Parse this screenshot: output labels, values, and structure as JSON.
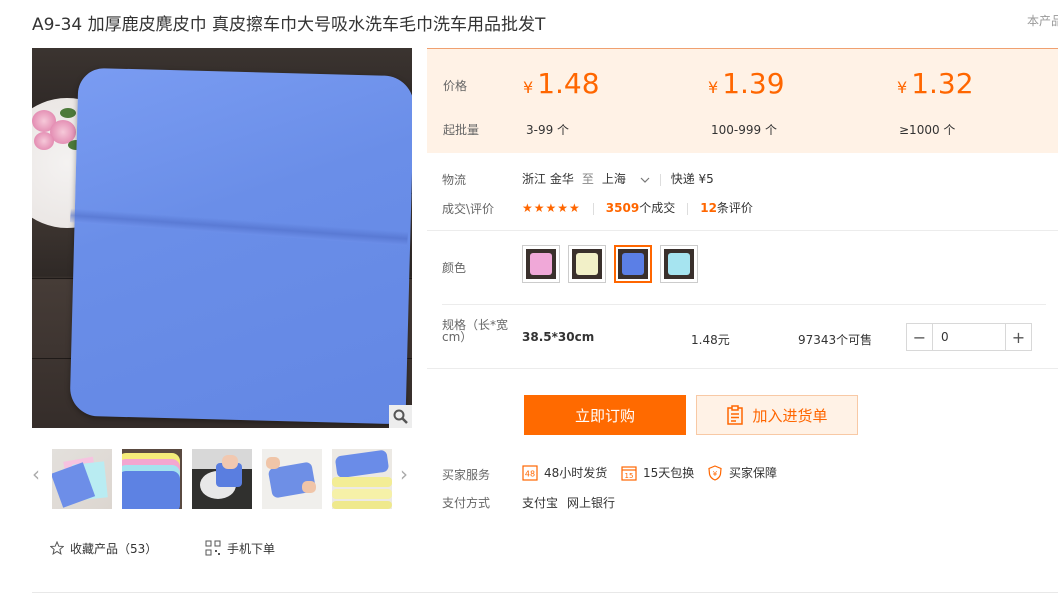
{
  "title": "A9-34 加厚鹿皮麂皮巾 真皮擦车巾大号吸水洗车毛巾洗车用品批发T",
  "title_right": "本产品",
  "price_panel": {
    "price_label": "价格",
    "qty_label": "起批量",
    "currency": "¥",
    "tiers": [
      {
        "price": "1.48",
        "qty": "3-99 个"
      },
      {
        "price": "1.39",
        "qty": "100-999 个"
      },
      {
        "price": "1.32",
        "qty": "≥1000 个"
      }
    ]
  },
  "logistics": {
    "label": "物流",
    "from": "浙江 金华",
    "to_word": "至",
    "to": "上海",
    "express": "快递 ¥5"
  },
  "deals": {
    "label": "成交\\评价",
    "stars": "★★★★★",
    "deal_count": "3509",
    "deal_suffix": "个成交",
    "review_count": "12",
    "review_suffix": "条评价"
  },
  "color": {
    "label": "颜色",
    "swatches": [
      {
        "name": "pink",
        "color": "#f0a8d8"
      },
      {
        "name": "cream",
        "color": "#f2f0c8"
      },
      {
        "name": "blue",
        "color": "#5b7fe6"
      },
      {
        "name": "light-blue",
        "color": "#a6e4f0"
      }
    ],
    "selected_index": 2
  },
  "spec": {
    "label": "规格（长*宽cm）",
    "size": "38.5*30cm",
    "price": "1.48元",
    "stock": "97343个可售",
    "quantity": "0",
    "minus": "−",
    "plus": "+"
  },
  "buttons": {
    "buy": "立即订购",
    "cart": "加入进货单"
  },
  "services": {
    "label": "买家服务",
    "items": [
      "48小时发货",
      "15天包换",
      "买家保障"
    ],
    "icons": [
      "48",
      "15",
      "shield"
    ]
  },
  "payment": {
    "label": "支付方式",
    "methods": [
      "支付宝",
      "网上银行"
    ]
  },
  "actions": {
    "favorite": "收藏产品（53）",
    "mobile": "手机下单"
  },
  "thumbnail_nav": {
    "prev": "‹",
    "next": "›"
  }
}
